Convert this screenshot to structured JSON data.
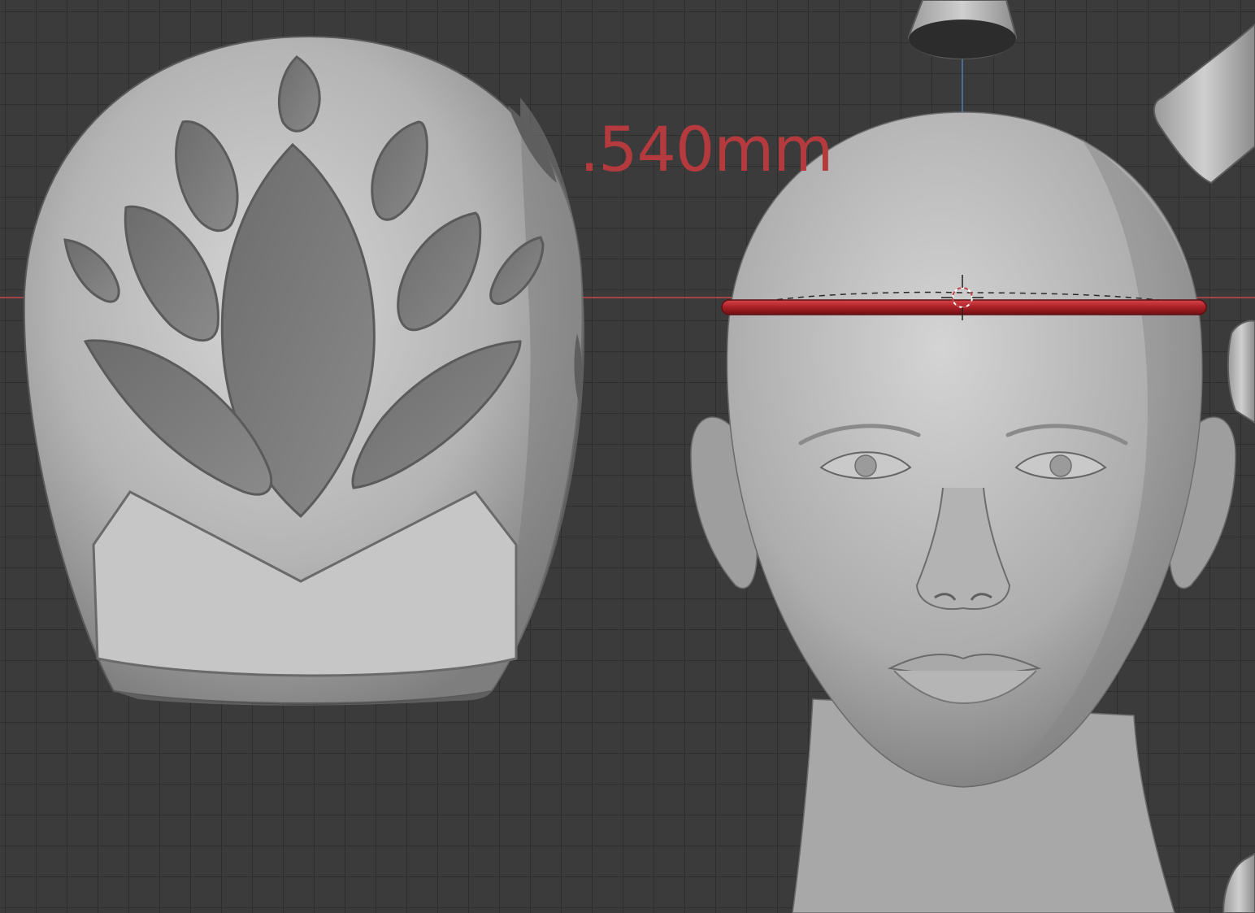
{
  "viewport": {
    "measurement_label": ".540mm",
    "colors": {
      "background": "#3b3b3b",
      "grid_line": "#2e2e2e",
      "x_axis": "#c4474b",
      "z_axis": "#4f7fbf",
      "measure_ring": "#b0242a",
      "mesh": "#b9b9b9"
    }
  },
  "objects": {
    "helmet": "helmet-mesh",
    "head": "head-mesh",
    "ring": "head-circumference-ring"
  }
}
